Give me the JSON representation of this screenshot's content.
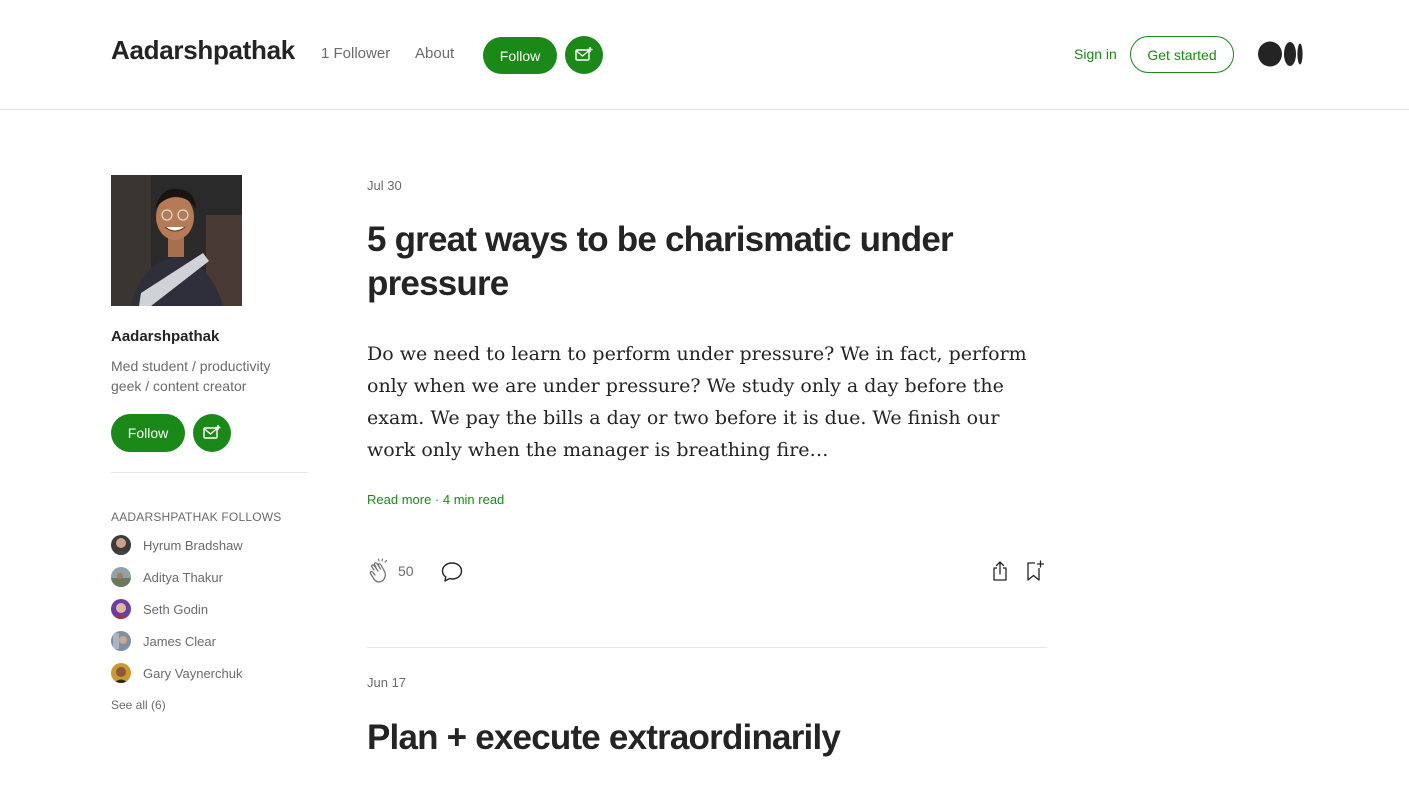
{
  "header": {
    "brand": "Aadarshpathak",
    "followers": "1 Follower",
    "about": "About",
    "follow_label": "Follow",
    "signin": "Sign in",
    "get_started": "Get started"
  },
  "sidebar": {
    "name": "Aadarshpathak",
    "bio": "Med student / productivity geek / content creator",
    "follow_label": "Follow",
    "follows_title": "AADARSHPATHAK FOLLOWS",
    "follows": [
      {
        "name": "Hyrum Bradshaw"
      },
      {
        "name": "Aditya Thakur"
      },
      {
        "name": "Seth Godin"
      },
      {
        "name": "James Clear"
      },
      {
        "name": "Gary Vaynerchuk"
      }
    ],
    "see_all": "See all (6)"
  },
  "posts": [
    {
      "date": "Jul 30",
      "title": "5 great ways to be charismatic under pressure",
      "excerpt": "Do we need to learn to perform under pressure? We in fact, perform only when we are under pressure? We study only a day before the exam. We pay the bills a day or two before it is due. We finish our work only when the manager is breathing fire…",
      "read_more": "Read more · 4 min read",
      "claps": "50"
    },
    {
      "date": "Jun 17",
      "title": "Plan + execute extraordinarily"
    }
  ],
  "colors": {
    "accent": "#1a8917",
    "text": "#242424",
    "muted": "#6b6b6b",
    "divider": "#e6e6e6"
  }
}
